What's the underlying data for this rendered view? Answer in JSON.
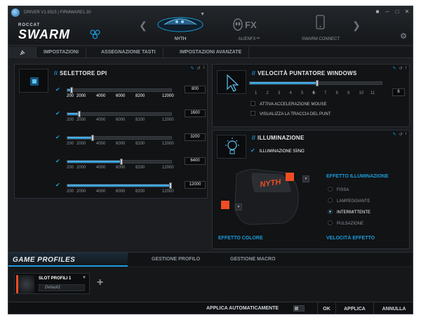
{
  "header": {
    "driver_info": "DRIVER V1.9315 | FIRMWARE1.30",
    "brand": "ROCCAT",
    "product": "SWARM",
    "devices": [
      {
        "label": "NYTH",
        "active": true
      },
      {
        "label": "ALIENFX™",
        "active": false
      },
      {
        "label": "SWARM CONNECT",
        "active": false
      }
    ],
    "window_controls": [
      "■",
      "–",
      "□",
      "✕"
    ],
    "alienfx_logo": "FX"
  },
  "tabs": {
    "pin_label": "📌",
    "items": [
      "IMPOSTAZIONI",
      "ASSEGNAZIONE TASTI",
      "IMPOSTAZIONI AVANZATE"
    ]
  },
  "dpi": {
    "title": "SELETTORE DPI",
    "slash": "//",
    "tick_labels": [
      "200",
      "2000",
      "4000",
      "6000",
      "8200",
      "12000"
    ],
    "rows": [
      {
        "value": "800",
        "fraction": 0.05
      },
      {
        "value": "1600",
        "fraction": 0.12
      },
      {
        "value": "3200",
        "fraction": 0.25
      },
      {
        "value": "6400",
        "fraction": 0.53
      },
      {
        "value": "12000",
        "fraction": 1.0
      }
    ]
  },
  "speed": {
    "title": "VELOCITÀ PUNTATORE WINDOWS",
    "slash": "//",
    "ticks": [
      "1",
      "2",
      "3",
      "4",
      "5",
      "6",
      "7",
      "8",
      "9",
      "10",
      "11"
    ],
    "value": "6",
    "options": [
      "ATTIVA ACCELERAZIONE MOUSE",
      "VISUALIZZA LA TRACCIA DEL PUNT"
    ]
  },
  "lighting": {
    "title": "ILLUMINAZIONE",
    "slash": "//",
    "toggle_label": "ILLUMINAZIONE SÌ/NO",
    "mouse_logo": "NYTH",
    "effect_title": "EFFETTO ILLUMINAZIONE",
    "effects": [
      {
        "label": "FISSA",
        "selected": false
      },
      {
        "label": "LAMPEGGIANTE",
        "selected": false
      },
      {
        "label": "INTERMITTENTE",
        "selected": true
      },
      {
        "label": "PULSAZIONE",
        "selected": false
      }
    ],
    "color_title": "EFFETTO COLORE",
    "speed_title": "VELOCITÀ EFFETTO",
    "accent_color": "#ef4c23"
  },
  "profiles": {
    "title": "GAME PROFILES",
    "tabs": [
      "GESTIONE PROFILO",
      "GESTIONE MACRO"
    ],
    "slot_name": "SLOT PROFILI 1",
    "profile_name": "Default1",
    "add_label": "+"
  },
  "footer": {
    "auto_apply": "APPLICA AUTOMATICAMENTE",
    "ok": "OK",
    "apply": "APPLICA",
    "cancel": "ANNULLA"
  },
  "colors": {
    "accent": "#1b9bdb",
    "orange": "#ef4c23",
    "background": "#1b1d20"
  }
}
